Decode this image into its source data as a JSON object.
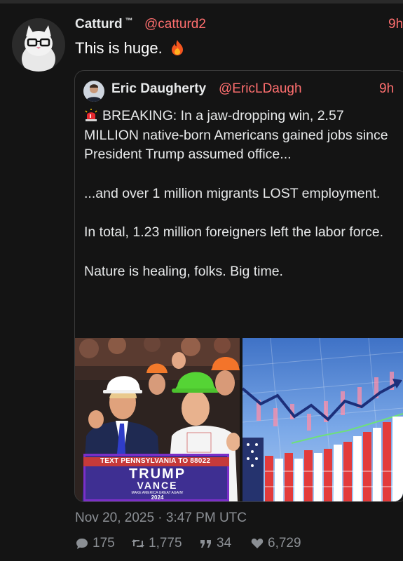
{
  "tweet": {
    "author_name": "Catturd",
    "author_badge": "™",
    "author_handle": "@catturd2",
    "time": "9h",
    "text": "This is huge.",
    "emoji": "fire-icon"
  },
  "quote": {
    "author_name": "Eric Daugherty",
    "author_handle": "@EricLDaugh",
    "time": "9h",
    "paragraphs": [
      "BREAKING: In a jaw-dropping win, 2.57 MILLION native-born Americans gained jobs since President Trump assumed office...",
      "...and over 1 million migrants LOST employment.",
      "In total, 1.23 million foreigners left the labor force.",
      "Nature is healing, folks. Big time."
    ],
    "lead_icon": "siren-icon",
    "images": {
      "left": {
        "sign_top": "TEXT PENNSYLVANIA TO 88022",
        "sign_main": "TRUMP",
        "sign_sub": "VANCE",
        "sign_small": "MAKE AMERICA GREAT AGAIN!",
        "sign_year": "2024"
      },
      "right": {}
    }
  },
  "meta": {
    "timestamp": "Nov 20, 2025 · 3:47 PM UTC"
  },
  "stats": {
    "replies": "175",
    "retweets": "1,775",
    "quotes": "34",
    "likes": "6,729"
  },
  "colors": {
    "background": "#141414",
    "accent": "#ff6f6f",
    "muted": "#8b8f94"
  }
}
